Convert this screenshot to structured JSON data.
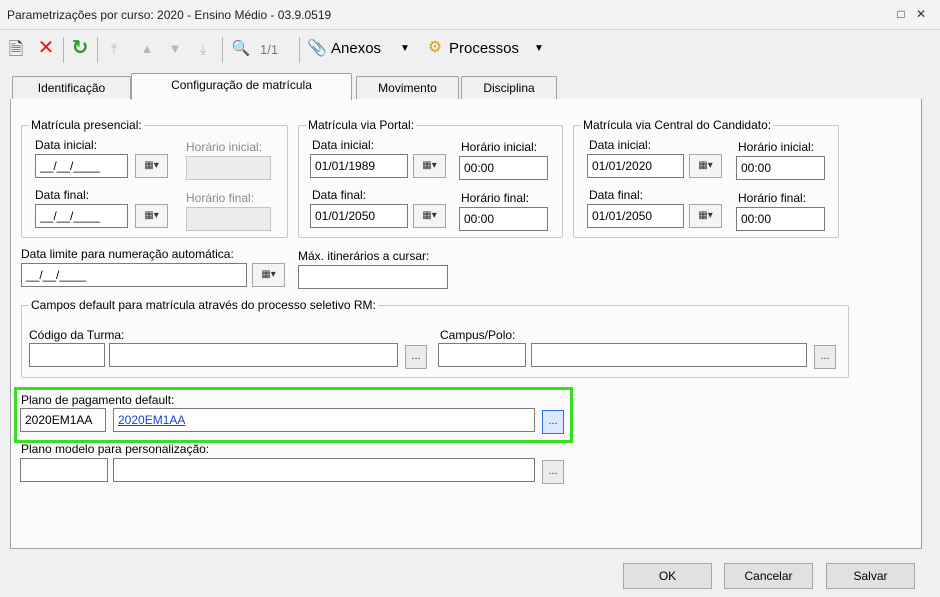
{
  "window": {
    "title": "Parametrizações por curso: 2020 - Ensino Médio - 03.9.0519"
  },
  "toolbar": {
    "record_counter": "1/1",
    "attachments_label": "Anexos",
    "processes_label": "Processos"
  },
  "tabs": [
    {
      "label": "Identificação"
    },
    {
      "label": "Configuração de matrícula"
    },
    {
      "label": "Movimento"
    },
    {
      "label": "Disciplina"
    }
  ],
  "presencial": {
    "legend": "Matrícula presencial:",
    "start_label": "Data inicial:",
    "start_value": "__/__/____",
    "start_time_label": "Horário inicial:",
    "end_label": "Data final:",
    "end_value": "__/__/____",
    "end_time_label": "Horário final:"
  },
  "portal": {
    "legend": "Matrícula via Portal:",
    "start_label": "Data inicial:",
    "start_value": "01/01/1989",
    "start_time_label": "Horário inicial:",
    "start_time_value": "00:00",
    "end_label": "Data final:",
    "end_value": "01/01/2050",
    "end_time_label": "Horário final:",
    "end_time_value": "00:00"
  },
  "central": {
    "legend": "Matrícula via Central do Candidato:",
    "start_label": "Data inicial:",
    "start_value": "01/01/2020",
    "start_time_label": "Horário inicial:",
    "start_time_value": "00:00",
    "end_label": "Data final:",
    "end_value": "01/01/2050",
    "end_time_label": "Horário final:",
    "end_time_value": "00:00"
  },
  "limit": {
    "label": "Data limite para numeração automática:",
    "value": "__/__/____"
  },
  "max_itineraries": {
    "label": "Máx. itinerários a cursar:",
    "value": ""
  },
  "rm_defaults": {
    "legend": "Campos default para matrícula através do processo seletivo RM:",
    "class_code_label": "Código da Turma:",
    "campus_label": "Campus/Polo:",
    "lookup_label": "..."
  },
  "payment_plan": {
    "label": "Plano de pagamento default:",
    "code": "2020EM1AA",
    "description": "2020EM1AA",
    "lookup_label": "..."
  },
  "model_plan": {
    "label": "Plano modelo para personalização:",
    "lookup_label": "..."
  },
  "buttons": {
    "ok": "OK",
    "cancel": "Cancelar",
    "save": "Salvar"
  },
  "colors": {
    "highlight": "#35e11f",
    "link": "#1a3fd0",
    "delete": "#e02020",
    "refresh": "#2a9a2a"
  }
}
